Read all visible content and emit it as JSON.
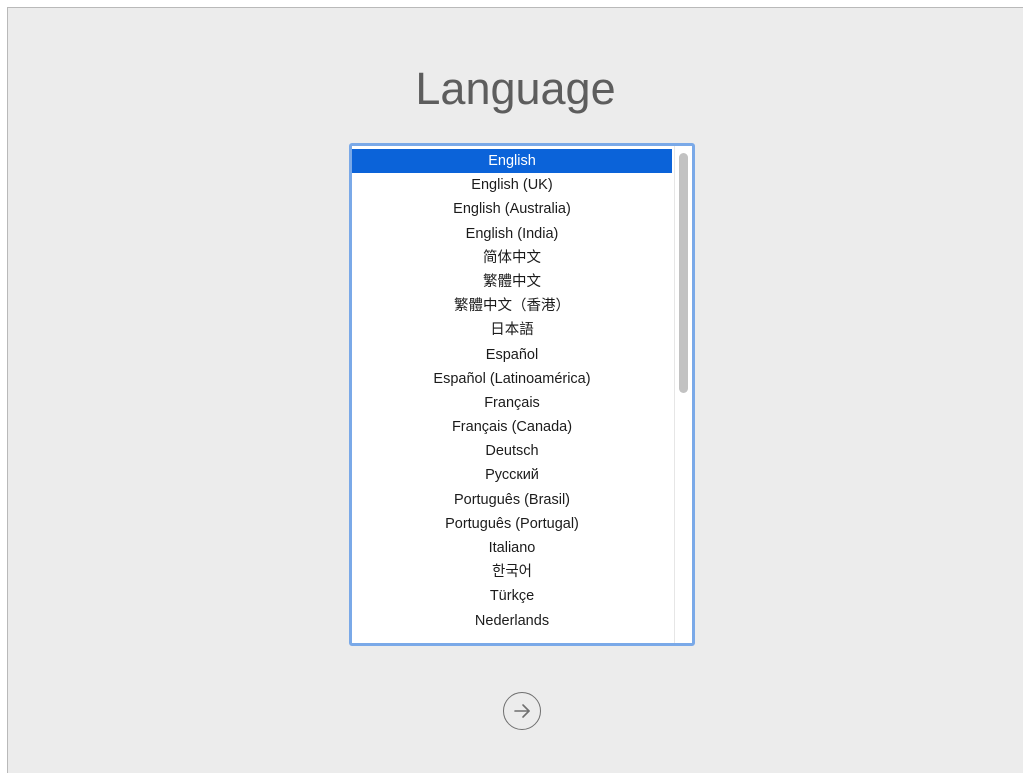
{
  "title": "Language",
  "languages": [
    "English",
    "English (UK)",
    "English (Australia)",
    "English (India)",
    "简体中文",
    "繁體中文",
    "繁體中文（香港）",
    "日本語",
    "Español",
    "Español (Latinoamérica)",
    "Français",
    "Français (Canada)",
    "Deutsch",
    "Русский",
    "Português (Brasil)",
    "Português (Portugal)",
    "Italiano",
    "한국어",
    "Türkçe",
    "Nederlands"
  ],
  "selected_language": "English",
  "colors": {
    "selection": "#0b63d9",
    "focus_ring": "#7aa9e8",
    "background": "#ececec"
  },
  "icons": {
    "next": "arrow-right-circle-icon"
  }
}
